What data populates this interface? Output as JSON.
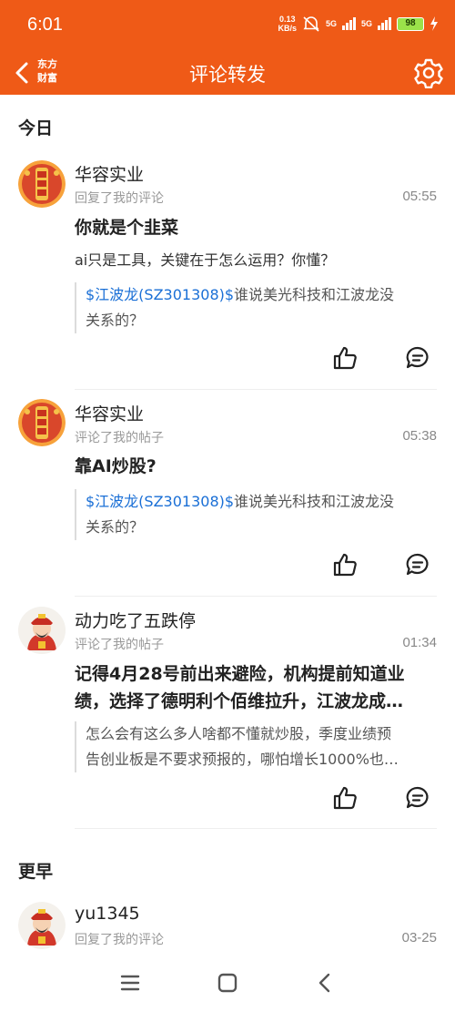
{
  "status": {
    "time": "6:01",
    "net_speed_value": "0.13",
    "net_speed_unit": "KB/s",
    "sim1": "5G",
    "sim2": "5G",
    "battery": "98"
  },
  "header": {
    "brand_line1": "东方",
    "brand_line2": "财富",
    "title": "评论转发"
  },
  "sections": {
    "today": "今日",
    "earlier": "更早"
  },
  "items": [
    {
      "user": "华容实业",
      "action": "回复了我的评论",
      "time": "05:55",
      "title": "你就是个韭菜",
      "text": "ai只是工具，关键在于怎么运用？你懂？",
      "quote_stock": "$江波龙(SZ301308)$",
      "quote_line1": "谁说美光科技和江波龙没",
      "quote_line2": "关系的？"
    },
    {
      "user": "华容实业",
      "action": "评论了我的帖子",
      "time": "05:38",
      "title": "靠AI炒股?",
      "quote_stock": "$江波龙(SZ301308)$",
      "quote_line1": "谁说美光科技和江波龙没",
      "quote_line2": "关系的？"
    },
    {
      "user": "动力吃了五跌停",
      "action": "评论了我的帖子",
      "time": "01:34",
      "title_line1": "记得4月28号前出来避险，机构提前知道业",
      "title_line2": "绩，选择了德明利个佰维拉升，江波龙成…",
      "quote_line1": "怎么会有这么多人啥都不懂就炒股，季度业绩预",
      "quote_line2": "告创业板是不要求预报的，哪怕增长1000%也…"
    },
    {
      "user": "yu1345",
      "action": "回复了我的评论",
      "time": "03-25"
    }
  ],
  "colors": {
    "brand": "#ef5a17",
    "link": "#1a6fd6"
  },
  "icons": [
    "back-icon",
    "gear-icon",
    "like-icon",
    "comment-icon",
    "menu-icon",
    "home-icon",
    "nav-back-icon"
  ]
}
